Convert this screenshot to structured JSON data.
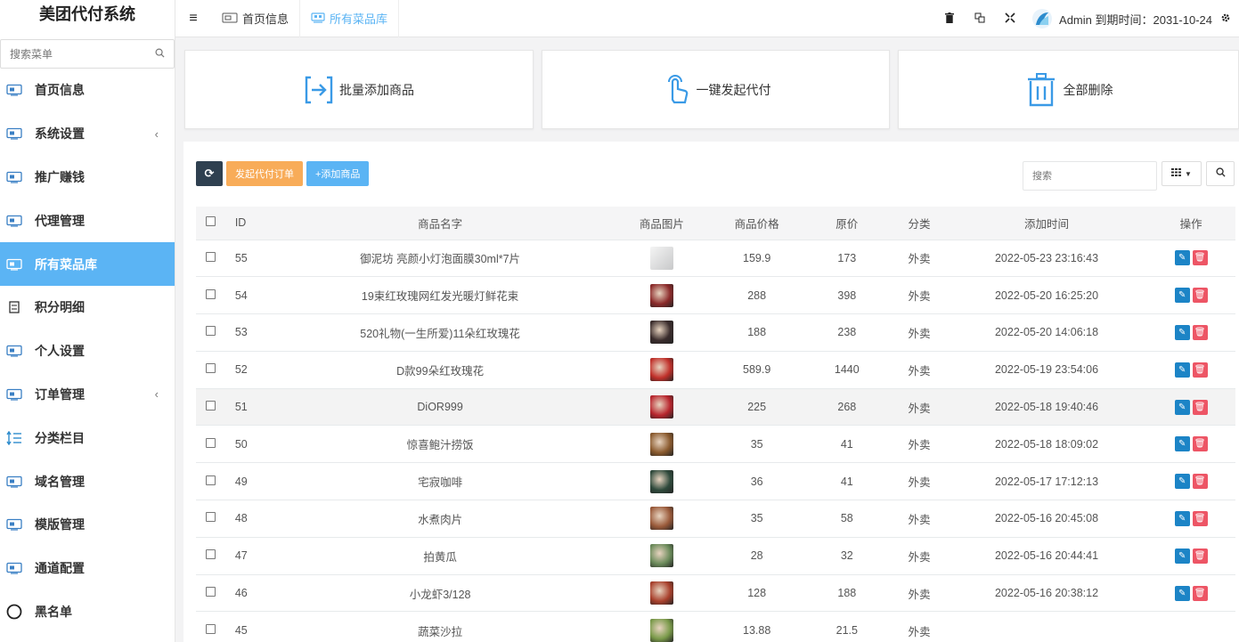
{
  "app": {
    "title": "美团代付系统"
  },
  "sidebar": {
    "search_placeholder": "搜索菜单",
    "items": [
      {
        "label": "首页信息",
        "icon": "monitor-icon",
        "has_arrow": false,
        "active": false
      },
      {
        "label": "系统设置",
        "icon": "settings-screen-icon",
        "has_arrow": true,
        "active": false
      },
      {
        "label": "推广赚钱",
        "icon": "promotion-icon",
        "has_arrow": false,
        "active": false
      },
      {
        "label": "代理管理",
        "icon": "agent-icon",
        "has_arrow": false,
        "active": false
      },
      {
        "label": "所有菜品库",
        "icon": "dish-library-icon",
        "has_arrow": false,
        "active": true
      },
      {
        "label": "积分明细",
        "icon": "points-icon",
        "has_arrow": false,
        "active": false
      },
      {
        "label": "个人设置",
        "icon": "personal-settings-icon",
        "has_arrow": false,
        "active": false
      },
      {
        "label": "订单管理",
        "icon": "order-icon",
        "has_arrow": true,
        "active": false
      },
      {
        "label": "分类栏目",
        "icon": "category-icon",
        "has_arrow": false,
        "active": false
      },
      {
        "label": "域名管理",
        "icon": "domain-icon",
        "has_arrow": false,
        "active": false
      },
      {
        "label": "模版管理",
        "icon": "template-icon",
        "has_arrow": false,
        "active": false
      },
      {
        "label": "通道配置",
        "icon": "channel-icon",
        "has_arrow": false,
        "active": false
      },
      {
        "label": "黑名单",
        "icon": "blacklist-icon",
        "has_arrow": false,
        "active": false
      }
    ],
    "arrow": "‹"
  },
  "topbar": {
    "tabs": [
      {
        "label": "首页信息",
        "active": false
      },
      {
        "label": "所有菜品库",
        "active": true
      }
    ],
    "user_text": "Admin 到期时间：2031-10-24"
  },
  "cards": [
    {
      "label": "批量添加商品",
      "icon": "batch-add-icon"
    },
    {
      "label": "一键发起代付",
      "icon": "tap-hand-icon"
    },
    {
      "label": "全部删除",
      "icon": "trash-icon"
    }
  ],
  "toolbar": {
    "refresh_icon": "⟳",
    "start_order_label": "发起代付订单",
    "add_product_label": "+添加商品",
    "search_placeholder": "搜索"
  },
  "table": {
    "headers": [
      "ID",
      "商品名字",
      "商品图片",
      "商品价格",
      "原价",
      "分类",
      "添加时间",
      "操作"
    ],
    "rows": [
      {
        "id": "55",
        "name": "御泥坊 亮颜小灯泡面膜30ml*7片",
        "price": "159.9",
        "orig": "173",
        "cat": "外卖",
        "time": "2022-05-23 23:16:43",
        "thumb": "#d9dadb"
      },
      {
        "id": "54",
        "name": "19束红玫瑰网红发光暖灯鲜花束",
        "price": "288",
        "orig": "398",
        "cat": "外卖",
        "time": "2022-05-20 16:25:20",
        "thumb": "#8b2a2a"
      },
      {
        "id": "53",
        "name": "520礼物(一生所爱)11朵红玫瑰花",
        "price": "188",
        "orig": "238",
        "cat": "外卖",
        "time": "2022-05-20 14:06:18",
        "thumb": "#3a2c2c"
      },
      {
        "id": "52",
        "name": "D款99朵红玫瑰花",
        "price": "589.9",
        "orig": "1440",
        "cat": "外卖",
        "time": "2022-05-19 23:54:06",
        "thumb": "#c0302a"
      },
      {
        "id": "51",
        "name": "DiOR999",
        "price": "225",
        "orig": "268",
        "cat": "外卖",
        "time": "2022-05-18 19:40:46",
        "thumb": "#b8252d"
      },
      {
        "id": "50",
        "name": "惊喜鲍汁捞饭",
        "price": "35",
        "orig": "41",
        "cat": "外卖",
        "time": "2022-05-18 18:09:02",
        "thumb": "#8a5a2e"
      },
      {
        "id": "49",
        "name": "宅寂咖啡",
        "price": "36",
        "orig": "41",
        "cat": "外卖",
        "time": "2022-05-17 17:12:13",
        "thumb": "#2f4a3c"
      },
      {
        "id": "48",
        "name": "水煮肉片",
        "price": "35",
        "orig": "58",
        "cat": "外卖",
        "time": "2022-05-16 20:45:08",
        "thumb": "#9a5a3a"
      },
      {
        "id": "47",
        "name": "拍黄瓜",
        "price": "28",
        "orig": "32",
        "cat": "外卖",
        "time": "2022-05-16 20:44:41",
        "thumb": "#6a8a5a"
      },
      {
        "id": "46",
        "name": "小龙虾3/128",
        "price": "128",
        "orig": "188",
        "cat": "外卖",
        "time": "2022-05-16 20:38:12",
        "thumb": "#a8402c"
      },
      {
        "id": "45",
        "name": "蔬菜沙拉",
        "price": "13.88",
        "orig": "21.5",
        "cat": "外卖",
        "time": "",
        "thumb": "#7a9a4a"
      }
    ],
    "highlight_row_index": 4
  },
  "colors": {
    "accent": "#5bb4f4",
    "orange": "#f8ac59",
    "dark": "#2f4050",
    "edit": "#1c84c6",
    "delete": "#ed5565"
  }
}
